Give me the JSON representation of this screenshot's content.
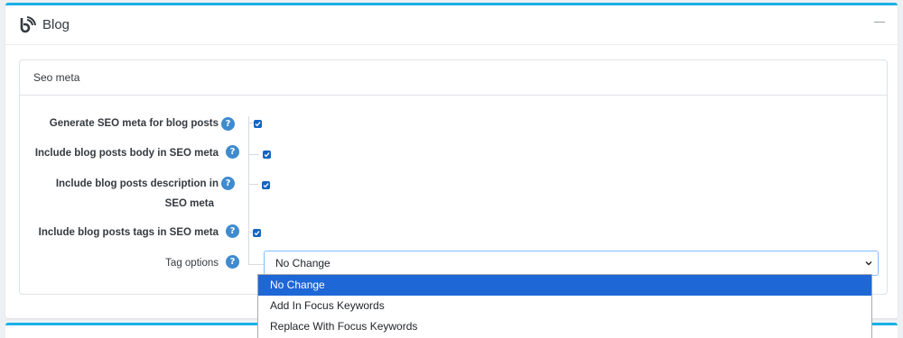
{
  "panel": {
    "title": "Blog",
    "icon": "blog-rss-icon",
    "collapse": "minus-icon"
  },
  "section": {
    "title": "Seo meta"
  },
  "settings": [
    {
      "label": "Generate SEO meta for blog posts",
      "checked": true
    },
    {
      "label": "Include blog posts body in SEO meta",
      "checked": true
    },
    {
      "label_line1": "Include blog posts description in",
      "label_line2": "SEO meta",
      "checked": true
    },
    {
      "label": "Include blog posts tags in SEO meta",
      "checked": true
    }
  ],
  "help_glyph": "?",
  "tag_options": {
    "label": "Tag options",
    "value": "No Change",
    "options": [
      "No Change",
      "Add In Focus Keywords",
      "Replace With Focus Keywords"
    ]
  },
  "colors": {
    "accent": "#17b1e6",
    "help": "#3f8bd0",
    "checkbox": "#1565c0",
    "selected": "#1e67d6"
  }
}
